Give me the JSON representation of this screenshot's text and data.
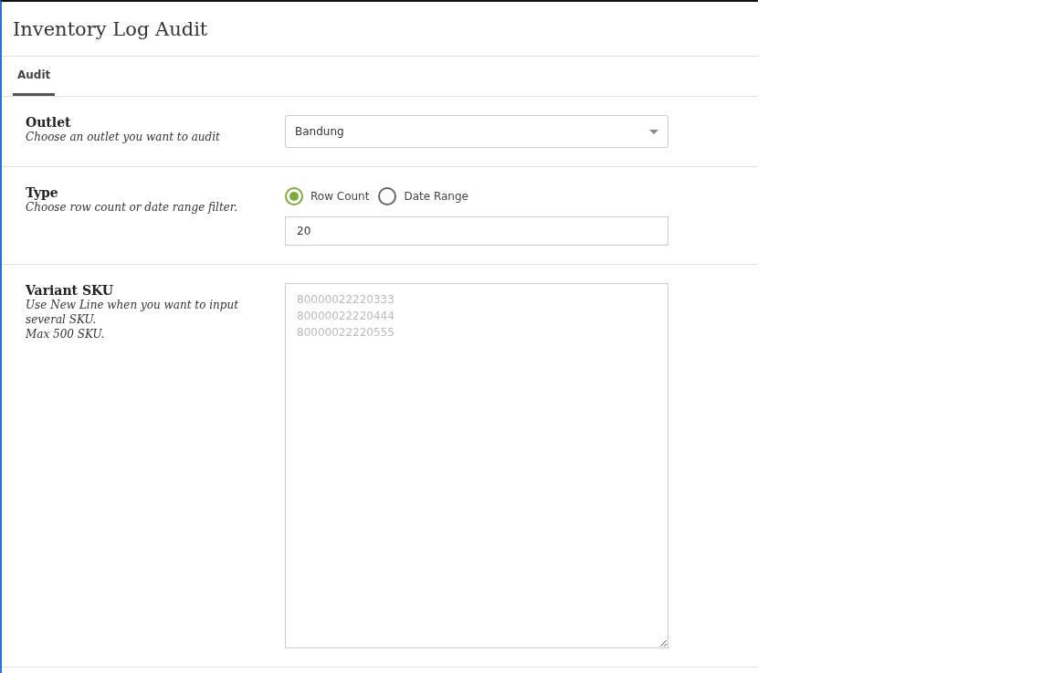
{
  "header": {
    "title": "Inventory Log Audit"
  },
  "tabs": [
    {
      "label": "Audit",
      "selected": true
    }
  ],
  "sections": [
    {
      "kind": "select",
      "label": "Outlet",
      "description": [
        "Choose an outlet you want to audit"
      ],
      "value": "Bandung"
    },
    {
      "kind": "radio",
      "label": "Type",
      "description": [
        "Choose row count or date range filter."
      ],
      "options": [
        {
          "label": "Row Count",
          "selected": true
        },
        {
          "label": "Date Range",
          "selected": false
        }
      ],
      "value": "20"
    },
    {
      "kind": "textarea",
      "label": "Variant SKU",
      "description": [
        "Use New Line when you want to input several SKU.",
        "Max 500 SKU."
      ],
      "placeholder": "80000022220333\n80000022220444\n80000022220555"
    }
  ]
}
